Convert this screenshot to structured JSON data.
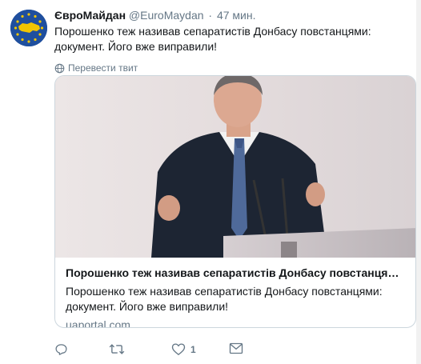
{
  "tweet": {
    "author": {
      "display_name": "ЄвроМайдан",
      "handle": "@EuroMaydan",
      "separator": "·",
      "time": "47 мин."
    },
    "text": "Порошенко теж називав сепаратистів Донбасу повстанцями: документ. Його вже виправили!",
    "translate_label": "Перевести твит",
    "card": {
      "title": "Порошенко теж називав сепаратистів Донбасу повстанцями: док...",
      "description": "Порошенко теж називав сепаратистів Донбасу повстанцями: документ. Його вже виправили!",
      "domain": "uaportal.com"
    },
    "actions": {
      "reply_icon": "reply-icon",
      "retweet_icon": "retweet-icon",
      "like_icon": "heart-icon",
      "like_count": "1",
      "dm_icon": "direct-message-icon"
    }
  },
  "colors": {
    "text_primary": "#14171a",
    "text_secondary": "#657786",
    "border": "#ccd6dd",
    "avatar_bg": "#1f4f9e",
    "avatar_map": "#f2c500"
  }
}
